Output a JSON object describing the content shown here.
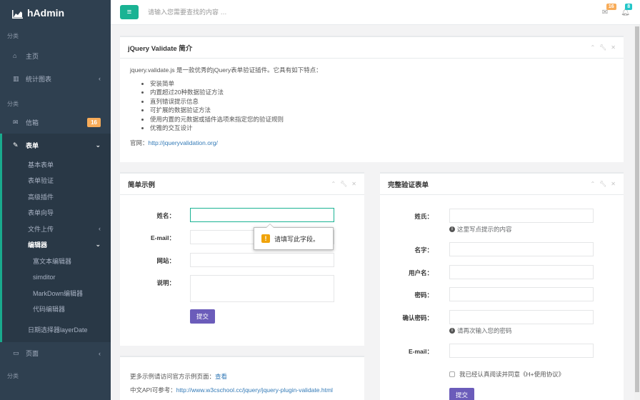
{
  "brand": {
    "name": "hAdmin"
  },
  "sidebar": {
    "section1": "分类",
    "home": "主页",
    "charts": "统计图表",
    "section2": "分类",
    "mailbox": "信箱",
    "mailbox_badge": "16",
    "forms": "表单",
    "sub": [
      "基本表单",
      "表单验证",
      "高级插件",
      "表单向导",
      "文件上传",
      "编辑器"
    ],
    "editors": [
      "富文本编辑器",
      "simditor",
      "MarkDown编辑器",
      "代码编辑器"
    ],
    "date_picker": "日期选择器layerDate",
    "pages": "页面",
    "section3": "分类"
  },
  "topbar": {
    "search_placeholder": "请输入您需要查找的内容 …",
    "mail_count": "16",
    "bell_count": "8"
  },
  "intro": {
    "title": "jQuery Validate 简介",
    "desc": "jquery.validate.js 是一款优秀的jQuery表单验证插件。它具有如下特点：",
    "features": [
      "安装简单",
      "内置超过20种数据验证方法",
      "直列错误提示信息",
      "可扩展的数据验证方法",
      "使用内置的元数据或插件选项来指定您的验证规则",
      "优雅的交互设计"
    ],
    "site_label": "官网：",
    "site_url": "http://jqueryvalidation.org/"
  },
  "simple": {
    "title": "简单示例",
    "name_label": "姓名：",
    "email_label": "E-mail：",
    "site_label": "网站：",
    "desc_label": "说明：",
    "submit": "提交",
    "tooltip": "请填写此字段。"
  },
  "more": {
    "line1": "更多示例请访问官方示例页面：",
    "line1_link": "查看",
    "line2": "中文API可参考：",
    "line2_link": "http://www.w3cschool.cc/jquery/jquery-plugin-validate.html"
  },
  "full": {
    "title": "完整验证表单",
    "surname": "姓氏：",
    "surname_hint": "这里写点提示的内容",
    "firstname": "名字：",
    "username": "用户名：",
    "password": "密码：",
    "confirm": "确认密码：",
    "confirm_hint": "请再次输入您的密码",
    "email": "E-mail：",
    "agree": "我已经认真阅读并同意《H+使用协议》",
    "submit": "提交"
  }
}
